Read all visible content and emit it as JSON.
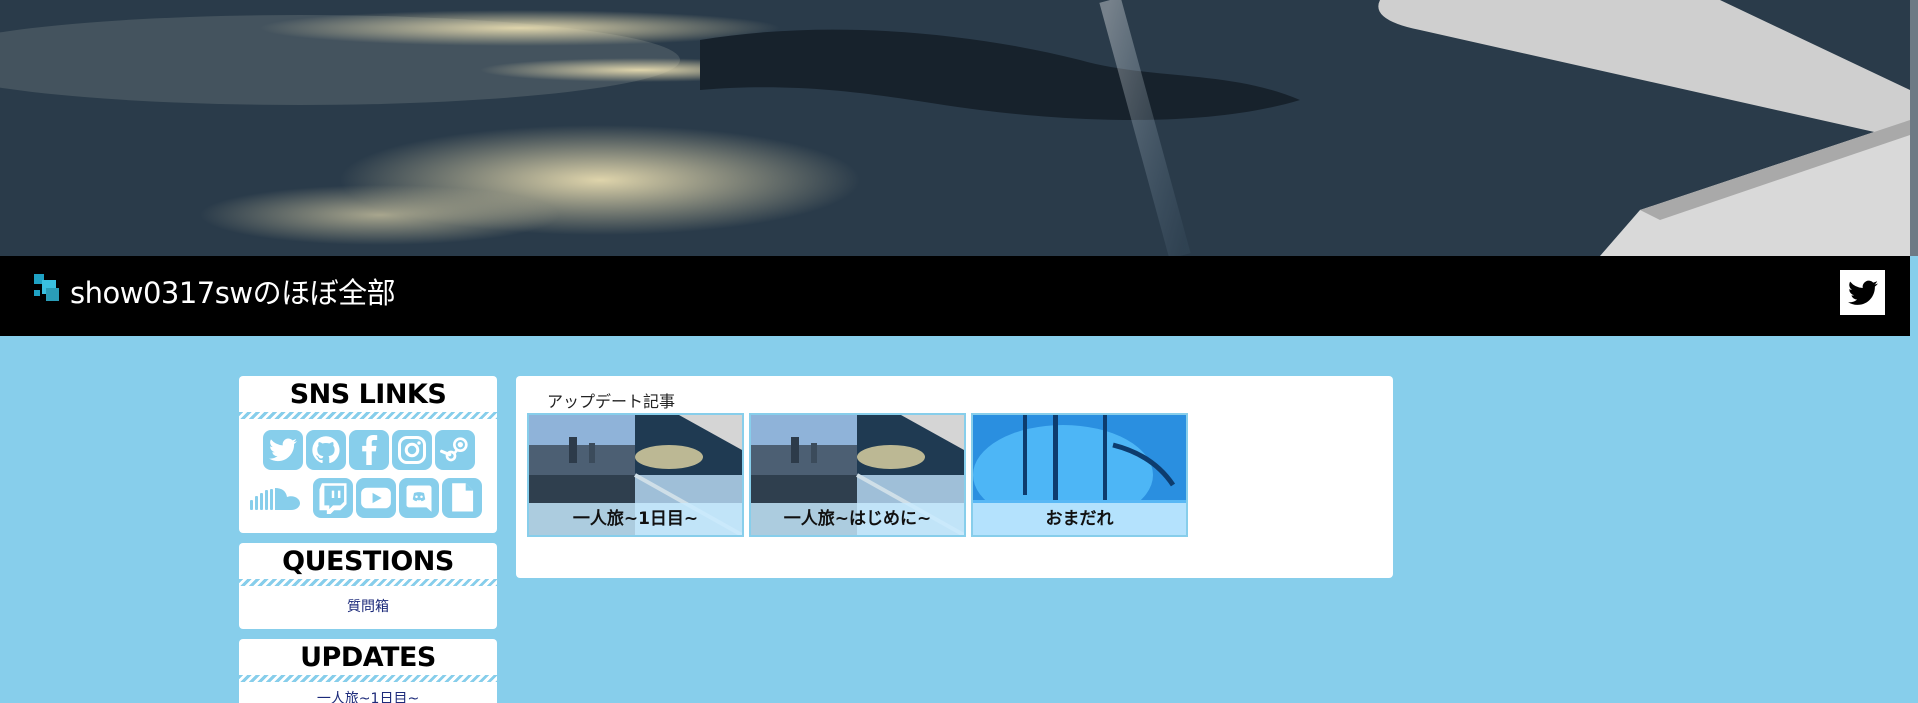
{
  "header": {
    "site_title": "show0317swのほぼ全部",
    "twitter_icon": "twitter-icon"
  },
  "sidebar": {
    "sns": {
      "title": "SNS LINKS",
      "icons": [
        "twitter-icon",
        "github-icon",
        "facebook-icon",
        "instagram-icon",
        "steam-icon",
        "soundcloud-icon",
        "twitch-icon",
        "youtube-icon",
        "discord-icon",
        "document-icon"
      ]
    },
    "questions": {
      "title": "QUESTIONS",
      "link": "質問箱"
    },
    "updates": {
      "title": "UPDATES",
      "link": "一人旅~1日目~"
    }
  },
  "main": {
    "section_label": "アップデート記事",
    "articles": [
      {
        "title": "一人旅~1日目~"
      },
      {
        "title": "一人旅~はじめに~"
      },
      {
        "title": "おまだれ"
      }
    ]
  },
  "colors": {
    "background": "#87ceeb",
    "header_bar": "#000000",
    "link": "#1c2a7a"
  }
}
